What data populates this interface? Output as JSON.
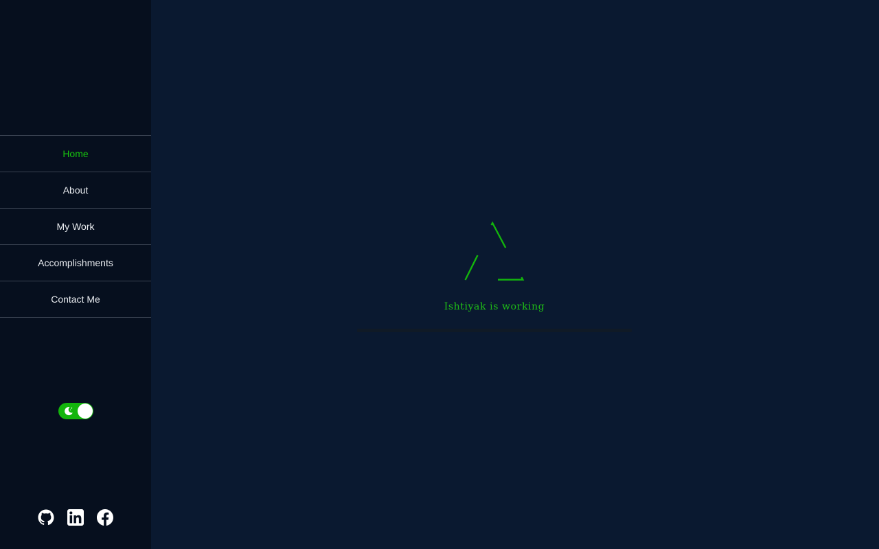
{
  "sidebar": {
    "nav": [
      {
        "label": "Home",
        "active": true
      },
      {
        "label": "About",
        "active": false
      },
      {
        "label": "My Work",
        "active": false
      },
      {
        "label": "Accomplishments",
        "active": false
      },
      {
        "label": "Contact Me",
        "active": false
      }
    ],
    "theme_toggle": {
      "state": "dark",
      "icon": "moon-icon"
    },
    "social": [
      {
        "icon": "github-icon"
      },
      {
        "icon": "linkedin-icon"
      },
      {
        "icon": "facebook-icon"
      }
    ]
  },
  "main": {
    "loader_text": "Ishtiyak is working",
    "progress": 0
  },
  "colors": {
    "accent": "#13b50c",
    "sidebar_bg": "#060f1e",
    "main_bg": "#0a1930",
    "nav_text": "#e8ebef"
  }
}
